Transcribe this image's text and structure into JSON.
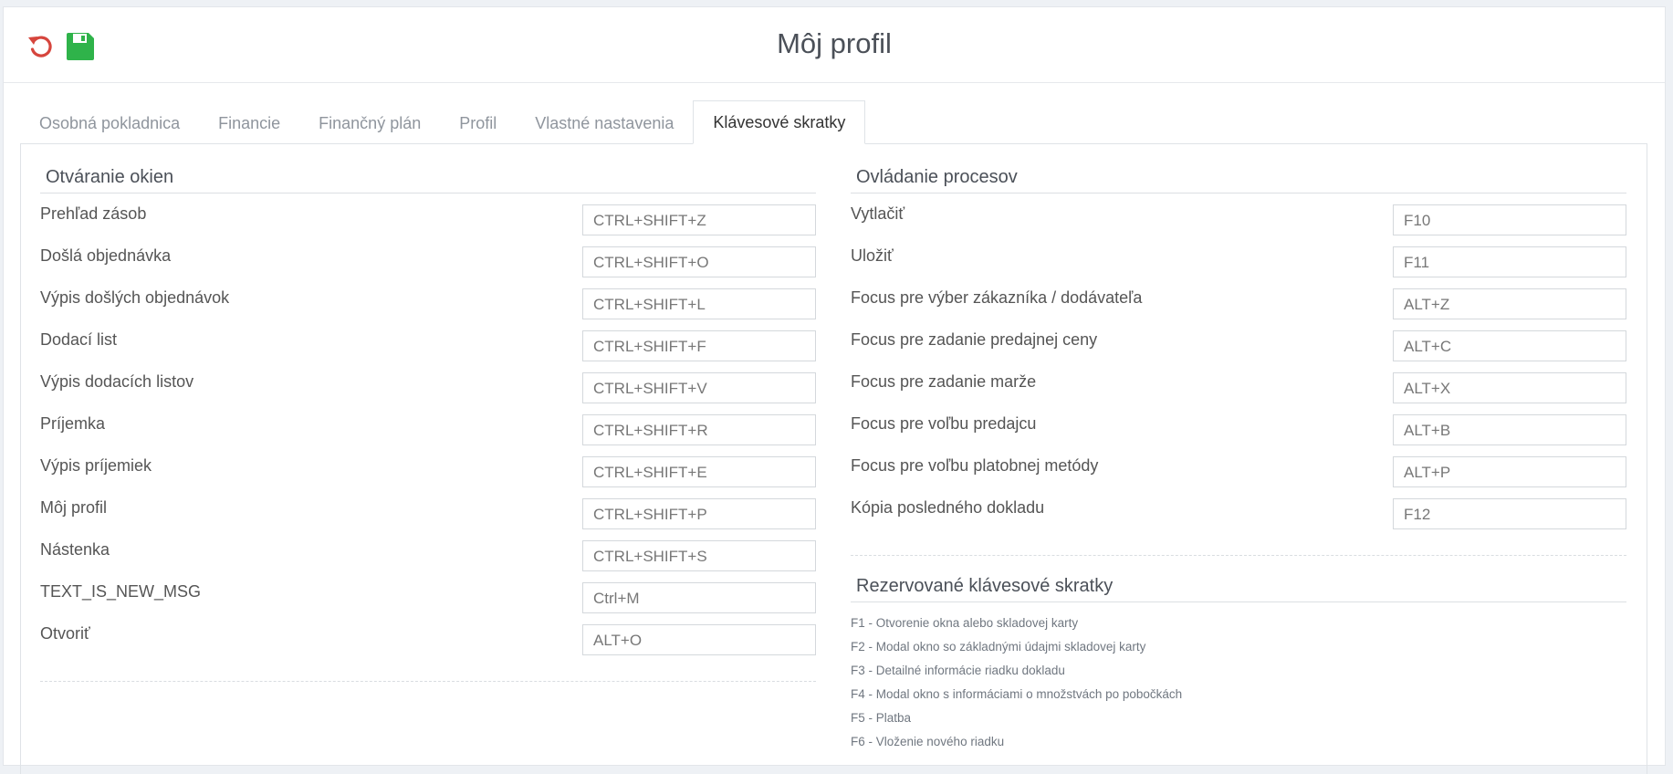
{
  "header": {
    "title": "Môj profil",
    "undo_icon": "undo-icon",
    "save_icon": "floppy-disk-icon",
    "undo_color": "#d6453d",
    "save_color": "#2fb34a"
  },
  "tabs": [
    {
      "label": "Osobná pokladnica"
    },
    {
      "label": "Financie"
    },
    {
      "label": "Finančný plán"
    },
    {
      "label": "Profil"
    },
    {
      "label": "Vlastné nastavenia"
    },
    {
      "label": "Klávesové skratky",
      "active": true
    }
  ],
  "windows": {
    "title": "Otváranie okien",
    "rows": [
      {
        "label": "Prehľad zásob",
        "key": "CTRL+SHIFT+Z"
      },
      {
        "label": "Došlá objednávka",
        "key": "CTRL+SHIFT+O"
      },
      {
        "label": "Výpis došlých objednávok",
        "key": "CTRL+SHIFT+L"
      },
      {
        "label": "Dodací list",
        "key": "CTRL+SHIFT+F"
      },
      {
        "label": "Výpis dodacích listov",
        "key": "CTRL+SHIFT+V"
      },
      {
        "label": "Príjemka",
        "key": "CTRL+SHIFT+R"
      },
      {
        "label": "Výpis príjemiek",
        "key": "CTRL+SHIFT+E"
      },
      {
        "label": "Môj profil",
        "key": "CTRL+SHIFT+P"
      },
      {
        "label": "Nástenka",
        "key": "CTRL+SHIFT+S"
      },
      {
        "label": "TEXT_IS_NEW_MSG",
        "key": "Ctrl+M"
      },
      {
        "label": "Otvoriť",
        "key": "ALT+O"
      }
    ]
  },
  "processes": {
    "title": "Ovládanie procesov",
    "rows": [
      {
        "label": "Vytlačiť",
        "key": "F10"
      },
      {
        "label": "Uložiť",
        "key": "F11"
      },
      {
        "label": "Focus pre výber zákazníka / dodávateľa",
        "key": "ALT+Z"
      },
      {
        "label": "Focus pre zadanie predajnej ceny",
        "key": "ALT+C"
      },
      {
        "label": "Focus pre zadanie marže",
        "key": "ALT+X"
      },
      {
        "label": "Focus pre voľbu predajcu",
        "key": "ALT+B"
      },
      {
        "label": "Focus pre voľbu platobnej metódy",
        "key": "ALT+P"
      },
      {
        "label": "Kópia posledného dokladu",
        "key": "F12"
      }
    ]
  },
  "reserved": {
    "title": "Rezervované klávesové skratky",
    "items": [
      "F1 - Otvorenie okna alebo skladovej karty",
      "F2 - Modal okno so základnými údajmi skladovej karty",
      "F3 - Detailné informácie riadku dokladu",
      "F4 - Modal okno s informáciami o množstvách po pobočkách",
      "F5 - Platba",
      "F6 - Vloženie nového riadku"
    ]
  }
}
